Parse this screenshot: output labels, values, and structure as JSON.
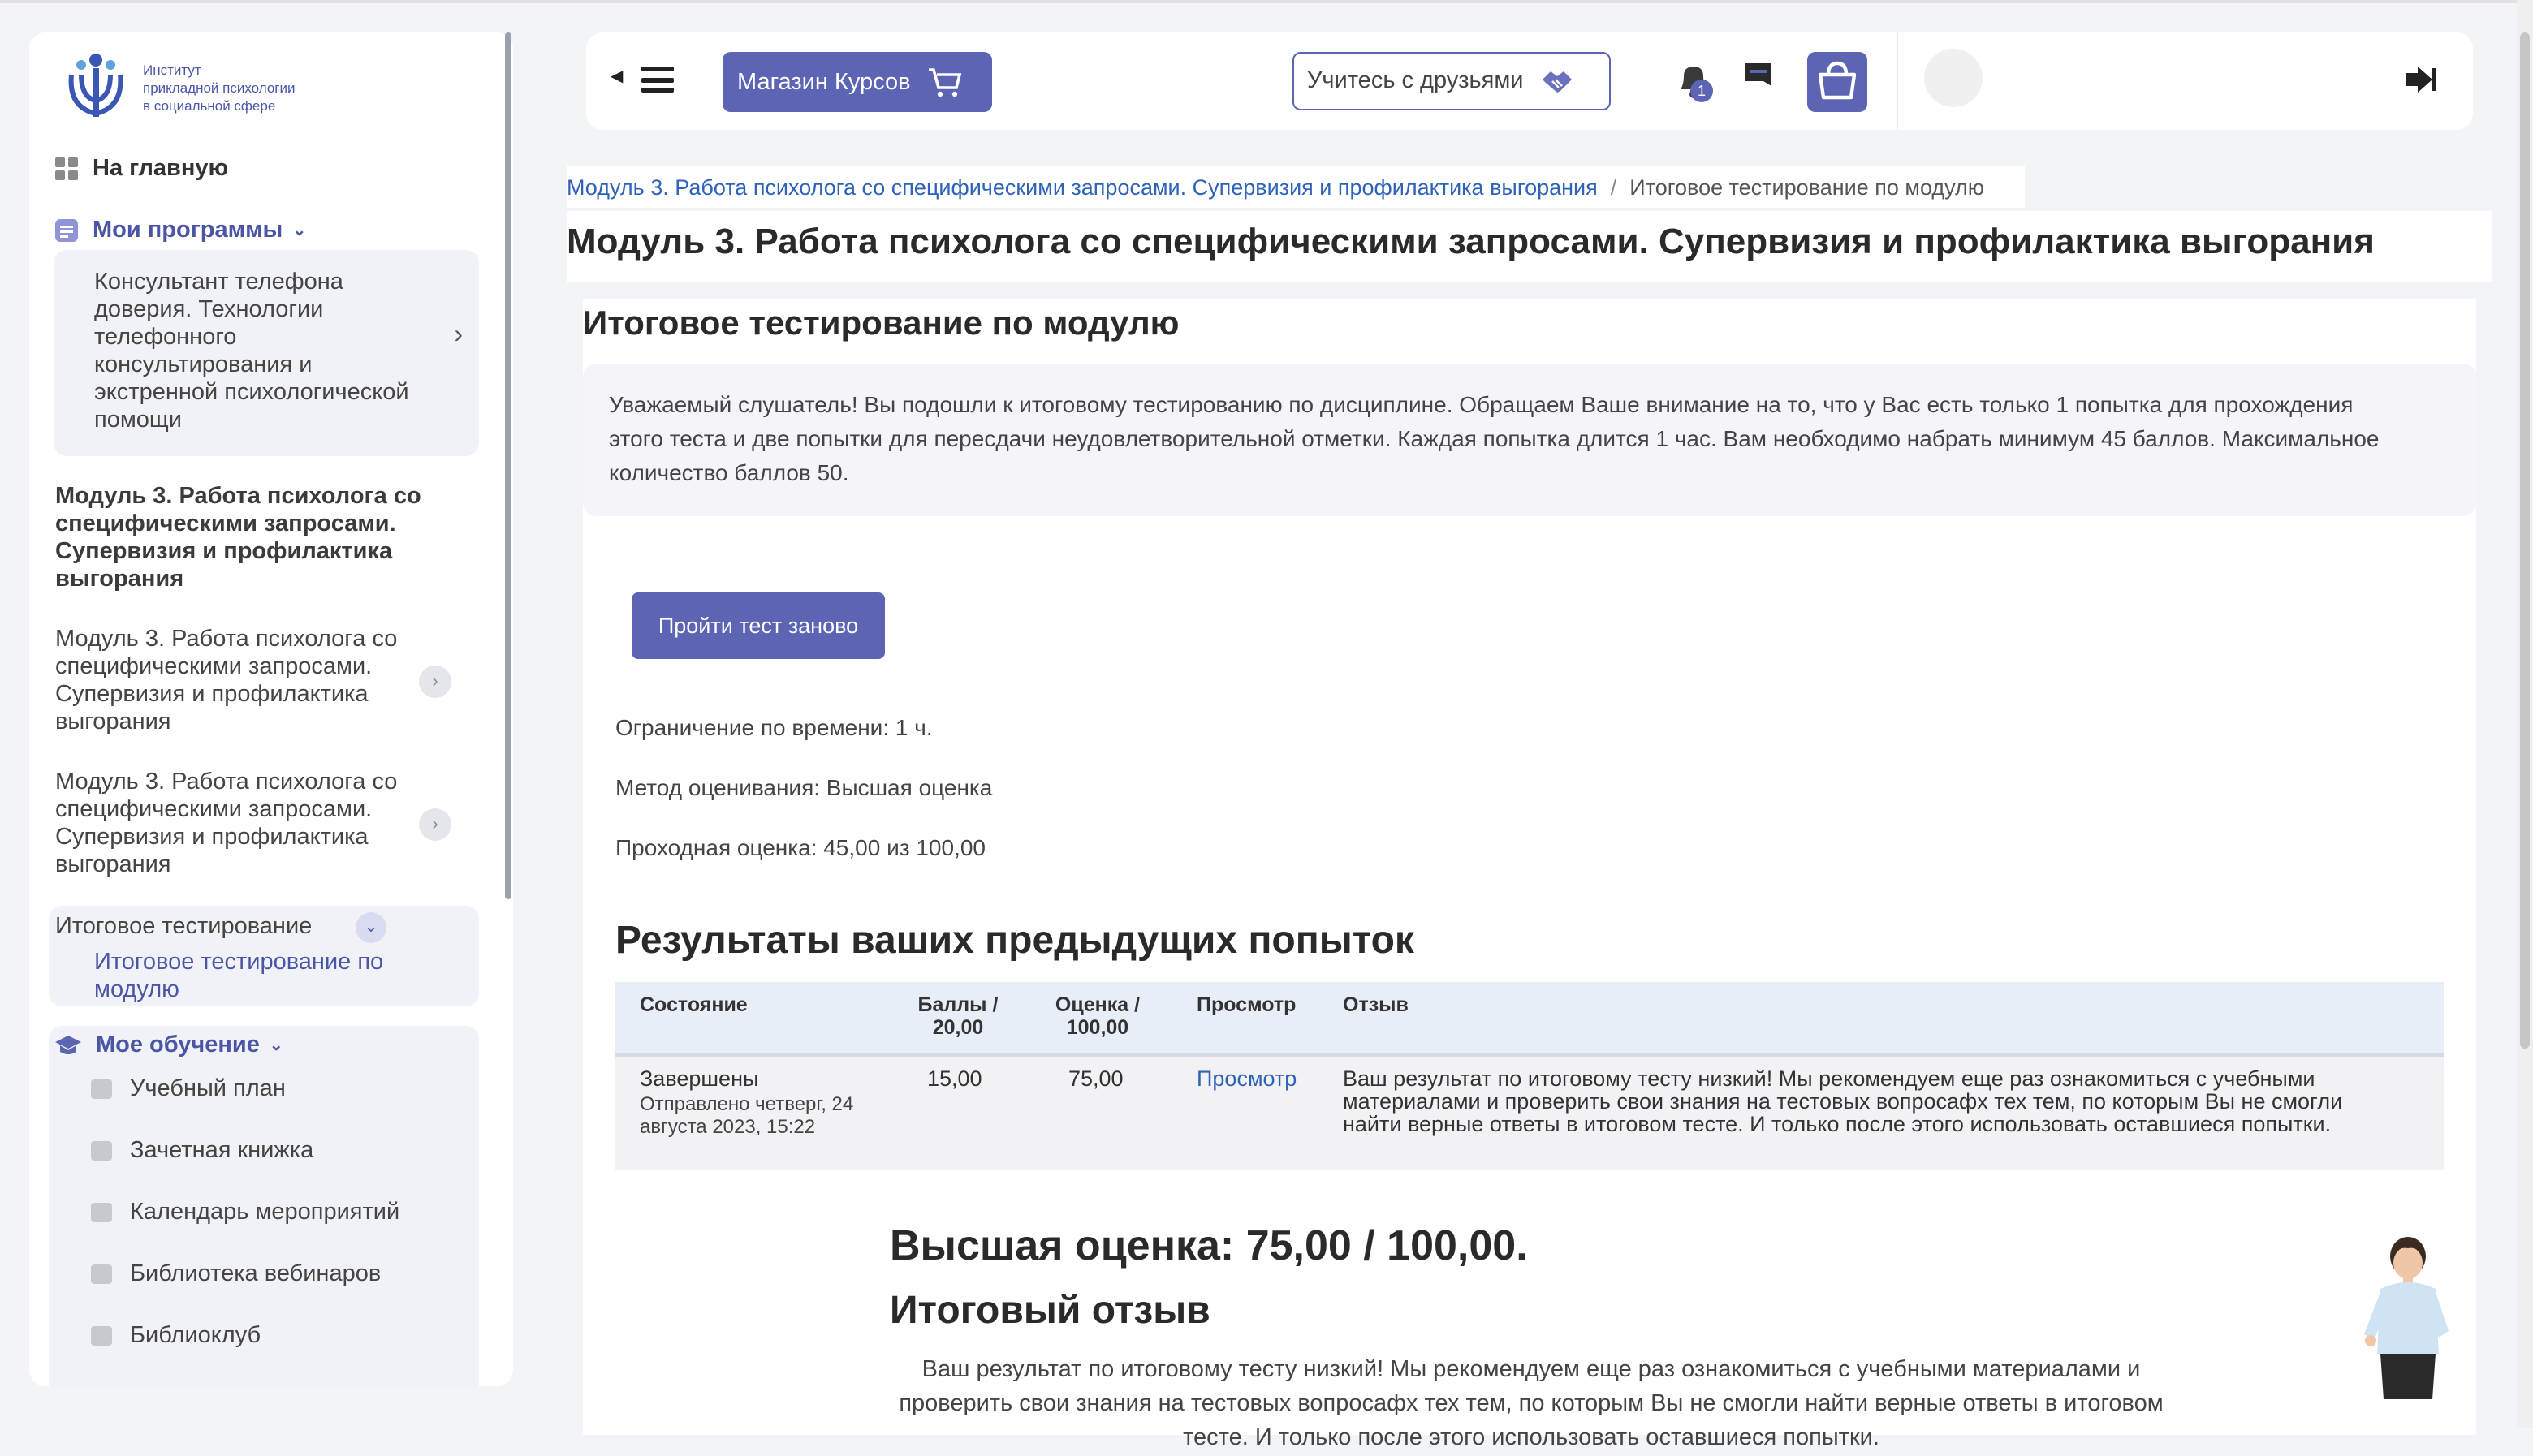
{
  "logo": {
    "text": "Институт\nприкладной психологии\nв социальной сфере"
  },
  "sidebar": {
    "home_label": "На главную",
    "programs_label": "Мои программы",
    "program_name": "Консультант телефона доверия. Технологии телефонного консультирования и экстренной психологической помощи",
    "current_module": "Модуль 3. Работа психолога со специфическими запросами. Супервизия и профилактика выгорания",
    "module_items": [
      "Модуль 3. Работа психолога со специфическими запросами. Супервизия и профилактика выгорания",
      "Модуль 3. Работа психолога со специфическими запросами. Супервизия и профилактика выгорания"
    ],
    "final_test_group": "Итоговое тестирование",
    "final_test_item": "Итоговое тестирование по модулю",
    "learning_label": "Мое обучение",
    "learning_items": [
      "Учебный план",
      "Зачетная книжка",
      "Календарь мероприятий",
      "Библиотека вебинаров",
      "Библиоклуб"
    ]
  },
  "header": {
    "shop_label": "Магазин Курсов",
    "friends_label": "Учитесь с друзьями",
    "notifications_count": "1"
  },
  "breadcrumb": {
    "module_link": "Модуль 3. Работа психолога со специфическими запросами. Супервизия и профилактика выгорания",
    "separator": "/",
    "current": "Итоговое тестирование по модулю"
  },
  "page": {
    "title": "Модуль 3. Работа психолога со специфическими запросами. Супервизия и профилактика выгорания",
    "activity_title": "Итоговое тестирование по модулю",
    "intro": "Уважаемый слушатель! Вы подошли к итоговому тестированию по дисциплине. Обращаем Ваше внимание на то, что у Вас есть только 1 попытка для прохождения этого теста и две попытки для пересдачи неудовлетворительной отметки. Каждая попытка длится 1 час. Вам необходимо набрать минимум 45 баллов. Максимальное количество баллов 50.",
    "retake_label": "Пройти тест заново",
    "time_limit": "Ограничение по времени: 1 ч.",
    "grading_method": "Метод оценивания: Высшая оценка",
    "pass_grade": "Проходная оценка: 45,00 из 100,00",
    "results_title": "Результаты ваших предыдущих попыток",
    "table": {
      "headers": [
        "Состояние",
        "Баллы / 20,00",
        "Оценка / 100,00",
        "Просмотр",
        "Отзыв"
      ],
      "row": {
        "state": "Завершены",
        "submitted": "Отправлено четверг, 24 августа 2023, 15:22",
        "points": "15,00",
        "grade": "75,00",
        "review": "Просмотр",
        "feedback": "Ваш результат по итоговому тесту низкий! Мы рекомендуем еще раз ознакомиться с учебными материалами и проверить свои знания на тестовых вопросафх тех тем, по которым Вы не смогли найти верные ответы в итоговом тесте. И только после этого использовать оставшиеся попытки."
      }
    },
    "best_grade": "Высшая оценка: 75,00 / 100,00.",
    "final_feedback_title": "Итоговый отзыв",
    "final_feedback": "Ваш результат по итоговому тесту низкий! Мы рекомендуем еще раз ознакомиться с учебными материалами и проверить свои знания на тестовых вопросафх тех тем, по которым Вы не смогли найти верные ответы в итоговом тесте. И только после этого использовать оставшиеся попытки."
  },
  "colors": {
    "accent": "#5c64b3",
    "link": "#2f63b8",
    "table_header": "#e8eef7"
  }
}
